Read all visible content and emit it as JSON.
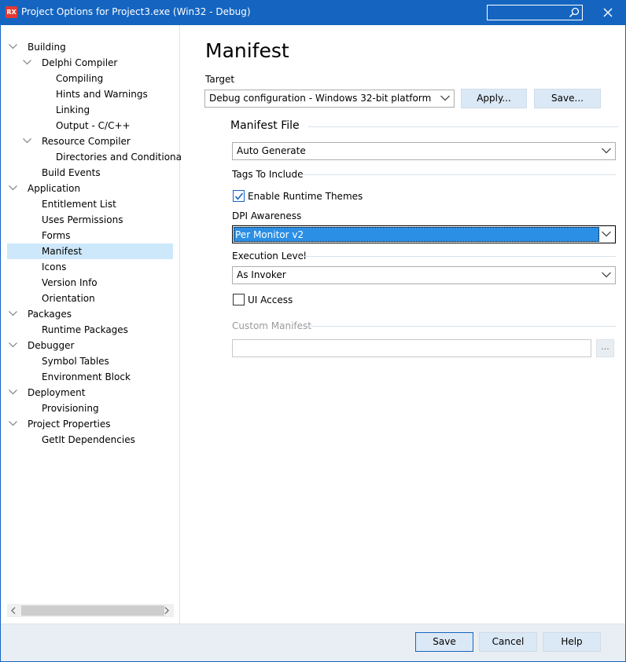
{
  "window": {
    "logo": "RX",
    "title": "Project Options for Project3.exe  (Win32 - Debug)",
    "search_placeholder": ""
  },
  "tree": [
    {
      "label": "Building",
      "level": 0,
      "expanded": true
    },
    {
      "label": "Delphi Compiler",
      "level": 1,
      "expanded": true
    },
    {
      "label": "Compiling",
      "level": 2
    },
    {
      "label": "Hints and Warnings",
      "level": 2
    },
    {
      "label": "Linking",
      "level": 2
    },
    {
      "label": "Output - C/C++",
      "level": 2
    },
    {
      "label": "Resource Compiler",
      "level": 1,
      "expanded": true
    },
    {
      "label": "Directories and Conditionals",
      "level": 2
    },
    {
      "label": "Build Events",
      "level": 1
    },
    {
      "label": "Application",
      "level": 0,
      "expanded": true
    },
    {
      "label": "Entitlement List",
      "level": 1
    },
    {
      "label": "Uses Permissions",
      "level": 1
    },
    {
      "label": "Forms",
      "level": 1
    },
    {
      "label": "Manifest",
      "level": 1,
      "selected": true
    },
    {
      "label": "Icons",
      "level": 1
    },
    {
      "label": "Version Info",
      "level": 1
    },
    {
      "label": "Orientation",
      "level": 1
    },
    {
      "label": "Packages",
      "level": 0,
      "expanded": true
    },
    {
      "label": "Runtime Packages",
      "level": 1
    },
    {
      "label": "Debugger",
      "level": 0,
      "expanded": true
    },
    {
      "label": "Symbol Tables",
      "level": 1
    },
    {
      "label": "Environment Block",
      "level": 1
    },
    {
      "label": "Deployment",
      "level": 0,
      "expanded": true
    },
    {
      "label": "Provisioning",
      "level": 1
    },
    {
      "label": "Project Properties",
      "level": 0,
      "expanded": true
    },
    {
      "label": "GetIt Dependencies",
      "level": 1
    }
  ],
  "main": {
    "heading": "Manifest",
    "target_label": "Target",
    "target_value": "Debug configuration - Windows 32-bit platform",
    "apply_label": "Apply...",
    "save_label": "Save...",
    "manifest_file_label": "Manifest File",
    "manifest_file_value": "Auto Generate",
    "tags_label": "Tags To Include",
    "runtime_themes_label": "Enable Runtime Themes",
    "runtime_themes_checked": true,
    "dpi_label": "DPI Awareness",
    "dpi_value": "Per Monitor v2",
    "exec_label": "Execution Level",
    "exec_value": "As Invoker",
    "ui_access_label": "UI Access",
    "ui_access_checked": false,
    "custom_manifest_label": "Custom Manifest",
    "custom_manifest_value": "",
    "browse_label": "..."
  },
  "footer": {
    "save": "Save",
    "cancel": "Cancel",
    "help": "Help"
  },
  "colors": {
    "titlebar": "#1565c0",
    "selection": "#cde8fb",
    "button": "#dbe8f5",
    "combo_highlight": "#2b8fe6"
  }
}
